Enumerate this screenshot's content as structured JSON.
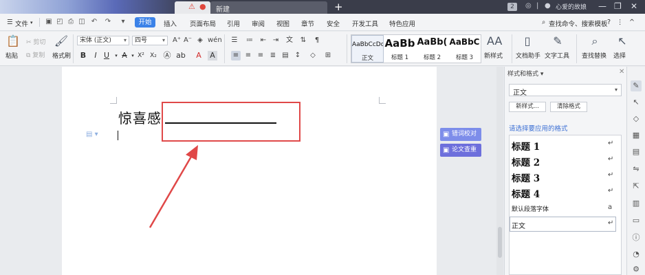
{
  "titlebar": {
    "tab_new": "新建",
    "plus": "+",
    "badge": "2",
    "user": "心爱的故娘",
    "controls": [
      "—",
      "❐",
      "✕"
    ]
  },
  "menubar": {
    "file": "文件",
    "start": "开始",
    "tabs": [
      "插入",
      "页面布局",
      "引用",
      "审阅",
      "视图",
      "章节",
      "安全",
      "开发工具",
      "特色应用"
    ],
    "search": "查找命令、搜索模板",
    "help": "?"
  },
  "ribbon": {
    "paste": "粘贴",
    "cut": "剪切",
    "copy": "复制",
    "format_painter": "格式刷",
    "font": "宋体 (正文)",
    "size": "四号",
    "styles": [
      {
        "sample": "AaBbCcDd",
        "caption": "正文"
      },
      {
        "sample": "AaBb",
        "caption": "标题 1"
      },
      {
        "sample": "AaBb(",
        "caption": "标题 2"
      },
      {
        "sample": "AaBbC",
        "caption": "标题 3"
      }
    ],
    "new_style": "新样式",
    "doc_assistant": "文档助手",
    "text_tools": "文字工具",
    "find_replace": "查找替换",
    "select": "选择"
  },
  "document": {
    "text": "惊喜感",
    "proofread": "错词校对",
    "paper_check": "论文查重"
  },
  "pane": {
    "title": "样式和格式",
    "current_style": "正文",
    "new_style_btn": "新样式...",
    "clear_format_btn": "清除格式",
    "hint": "请选择要应用的格式",
    "items": [
      "标题 1",
      "标题 2",
      "标题 3",
      "标题 4"
    ],
    "default_font": "默认段落字体",
    "body": "正文"
  }
}
